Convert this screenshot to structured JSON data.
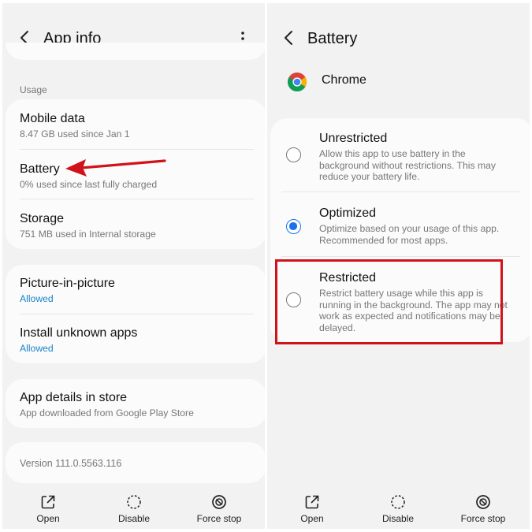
{
  "left": {
    "title": "App info",
    "section_label": "Usage",
    "usage_items": [
      {
        "label": "Mobile data",
        "sub": "8.47 GB used since Jan 1"
      },
      {
        "label": "Battery",
        "sub": "0% used since last fully charged"
      },
      {
        "label": "Storage",
        "sub": "751 MB used in Internal storage"
      }
    ],
    "perm_items": [
      {
        "label": "Picture-in-picture",
        "sub": "Allowed"
      },
      {
        "label": "Install unknown apps",
        "sub": "Allowed"
      }
    ],
    "store_item": {
      "label": "App details in store",
      "sub": "App downloaded from Google Play Store"
    },
    "version": "Version 111.0.5563.116",
    "bottom": [
      {
        "label": "Open",
        "icon": "open-external-icon"
      },
      {
        "label": "Disable",
        "icon": "disable-circle-icon"
      },
      {
        "label": "Force stop",
        "icon": "force-stop-icon"
      }
    ]
  },
  "right": {
    "title": "Battery",
    "app_name": "Chrome",
    "options": [
      {
        "label": "Unrestricted",
        "desc": "Allow this app to use battery in the background without restrictions. This may reduce your battery life.",
        "selected": false
      },
      {
        "label": "Optimized",
        "desc": "Optimize based on your usage of this app. Recommended for most apps.",
        "selected": true
      },
      {
        "label": "Restricted",
        "desc": "Restrict battery usage while this app is running in the background. The app may not work as expected and notifications may be delayed.",
        "selected": false
      }
    ],
    "bottom": [
      {
        "label": "Open",
        "icon": "open-external-icon"
      },
      {
        "label": "Disable",
        "icon": "disable-circle-icon"
      },
      {
        "label": "Force stop",
        "icon": "force-stop-icon"
      }
    ]
  },
  "colors": {
    "annotation_red": "#d0121b",
    "accent_blue": "#1a73e8",
    "allowed_blue": "#1a84c9"
  }
}
